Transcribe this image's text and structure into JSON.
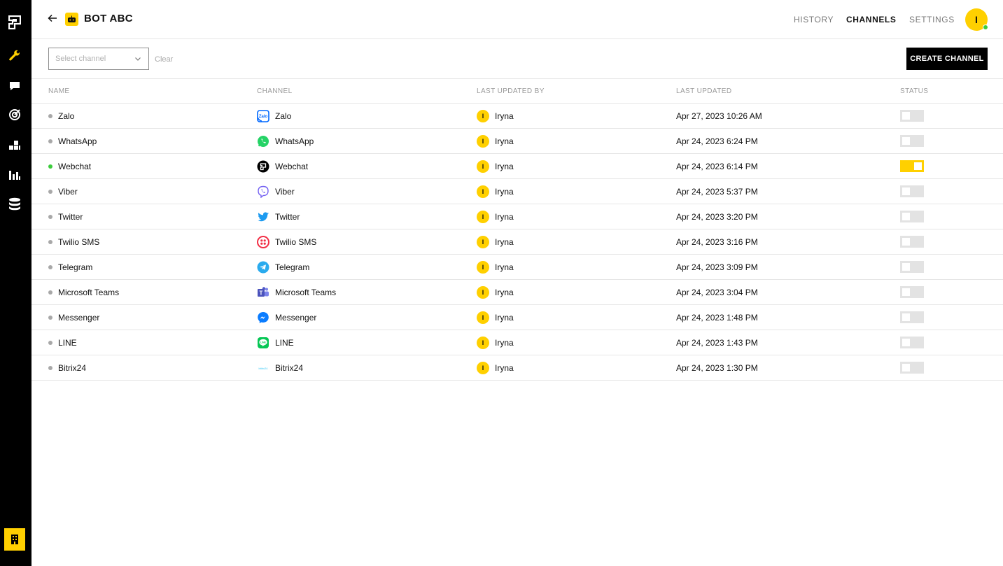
{
  "header": {
    "bot_name": "BOT ABC",
    "tabs": [
      {
        "label": "HISTORY",
        "active": false
      },
      {
        "label": "CHANNELS",
        "active": true
      },
      {
        "label": "SETTINGS",
        "active": false
      }
    ],
    "user_initial": "I"
  },
  "toolbar": {
    "select_placeholder": "Select channel",
    "clear_label": "Clear",
    "create_label": "CREATE CHANNEL"
  },
  "table": {
    "columns": [
      "NAME",
      "CHANNEL",
      "LAST UPDATED BY",
      "LAST UPDATED",
      "STATUS"
    ],
    "rows": [
      {
        "name": "Zalo",
        "channel": "Zalo",
        "icon": "zalo-icon",
        "user": "Iryna",
        "user_initial": "I",
        "updated": "Apr 27, 2023 10:26 AM",
        "active": false
      },
      {
        "name": "WhatsApp",
        "channel": "WhatsApp",
        "icon": "whatsapp-icon",
        "user": "Iryna",
        "user_initial": "I",
        "updated": "Apr 24, 2023 6:24 PM",
        "active": false
      },
      {
        "name": "Webchat",
        "channel": "Webchat",
        "icon": "webchat-icon",
        "user": "Iryna",
        "user_initial": "I",
        "updated": "Apr 24, 2023 6:14 PM",
        "active": true
      },
      {
        "name": "Viber",
        "channel": "Viber",
        "icon": "viber-icon",
        "user": "Iryna",
        "user_initial": "I",
        "updated": "Apr 24, 2023 5:37 PM",
        "active": false
      },
      {
        "name": "Twitter",
        "channel": "Twitter",
        "icon": "twitter-icon",
        "user": "Iryna",
        "user_initial": "I",
        "updated": "Apr 24, 2023 3:20 PM",
        "active": false
      },
      {
        "name": "Twilio SMS",
        "channel": "Twilio SMS",
        "icon": "twilio-icon",
        "user": "Iryna",
        "user_initial": "I",
        "updated": "Apr 24, 2023 3:16 PM",
        "active": false
      },
      {
        "name": "Telegram",
        "channel": "Telegram",
        "icon": "telegram-icon",
        "user": "Iryna",
        "user_initial": "I",
        "updated": "Apr 24, 2023 3:09 PM",
        "active": false
      },
      {
        "name": "Microsoft Teams",
        "channel": "Microsoft Teams",
        "icon": "teams-icon",
        "user": "Iryna",
        "user_initial": "I",
        "updated": "Apr 24, 2023 3:04 PM",
        "active": false
      },
      {
        "name": "Messenger",
        "channel": "Messenger",
        "icon": "messenger-icon",
        "user": "Iryna",
        "user_initial": "I",
        "updated": "Apr 24, 2023 1:48 PM",
        "active": false
      },
      {
        "name": "LINE",
        "channel": "LINE",
        "icon": "line-icon",
        "user": "Iryna",
        "user_initial": "I",
        "updated": "Apr 24, 2023 1:43 PM",
        "active": false
      },
      {
        "name": "Bitrix24",
        "channel": "Bitrix24",
        "icon": "bitrix24-icon",
        "user": "Iryna",
        "user_initial": "I",
        "updated": "Apr 24, 2023 1:30 PM",
        "active": false
      }
    ]
  },
  "colors": {
    "accent": "#ffd000",
    "sidebar": "#000000",
    "online": "#3ccc3c"
  },
  "sidebar_icons": [
    "logo-icon",
    "wrench-icon",
    "chat-icon",
    "target-icon",
    "blocks-icon",
    "analytics-icon",
    "database-icon",
    "building-icon"
  ]
}
